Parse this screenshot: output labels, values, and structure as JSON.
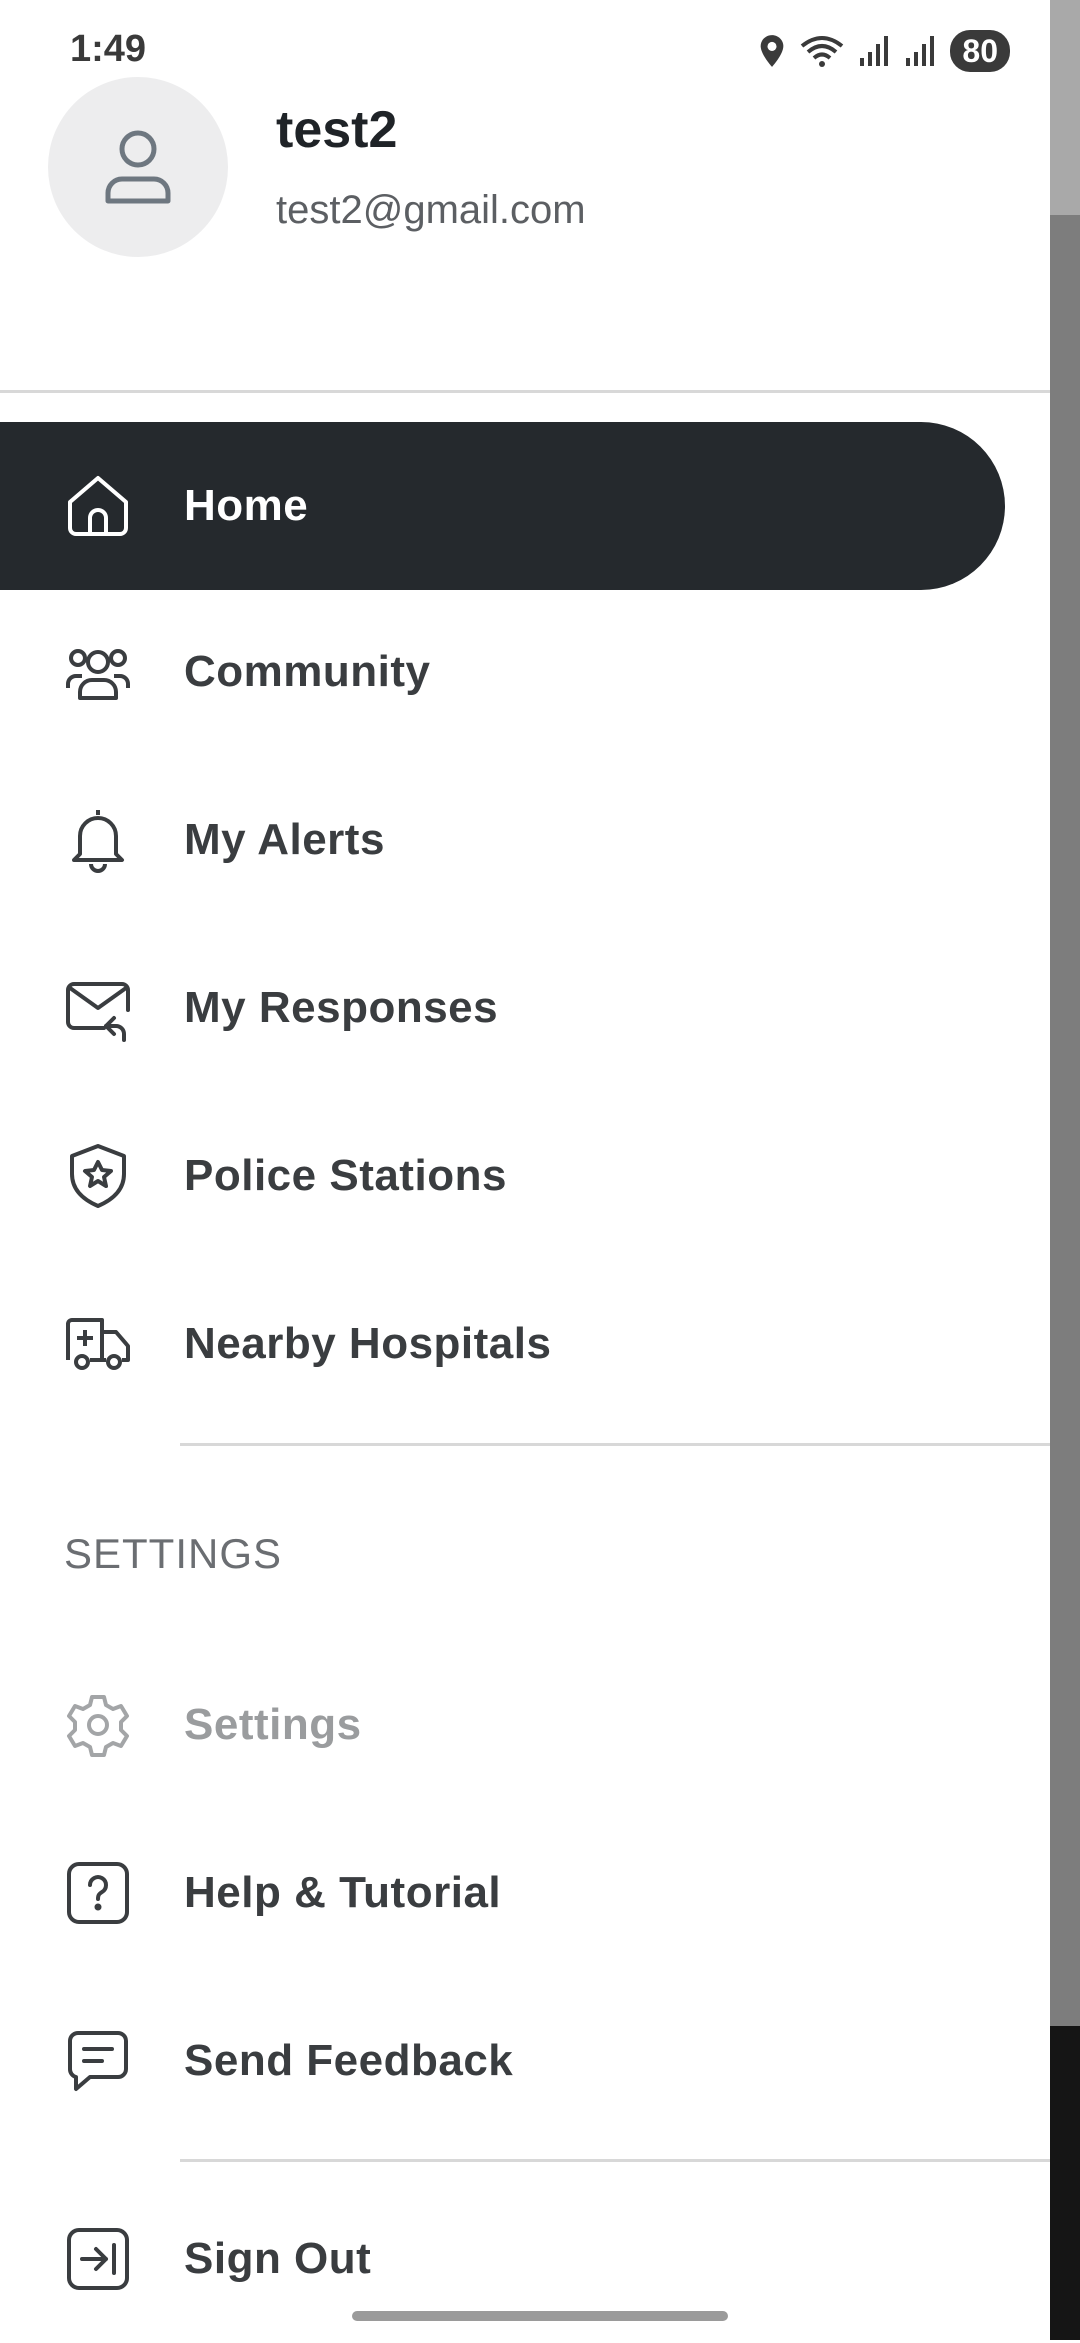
{
  "status_bar": {
    "time": "1:49",
    "battery": "80"
  },
  "profile": {
    "name": "test2",
    "email": "test2@gmail.com",
    "icon": "user-icon"
  },
  "nav": [
    {
      "label": "Home",
      "icon": "home-icon",
      "active": true
    },
    {
      "label": "Community",
      "icon": "users-icon"
    },
    {
      "label": "My Alerts",
      "icon": "bell-icon"
    },
    {
      "label": "My Responses",
      "icon": "mail-reply-icon"
    },
    {
      "label": "Police Stations",
      "icon": "police-badge-icon"
    },
    {
      "label": "Nearby Hospitals",
      "icon": "ambulance-icon"
    }
  ],
  "settings_section": {
    "title": "SETTINGS",
    "items": [
      {
        "label": "Settings",
        "icon": "gear-icon",
        "disabled": true
      },
      {
        "label": "Help & Tutorial",
        "icon": "help-icon"
      },
      {
        "label": "Send Feedback",
        "icon": "feedback-icon"
      }
    ]
  },
  "sign_out": {
    "label": "Sign Out",
    "icon": "logout-icon"
  },
  "colors": {
    "active_bg": "#25292d",
    "text": "#3a3d40",
    "muted": "#9a9c9e"
  }
}
